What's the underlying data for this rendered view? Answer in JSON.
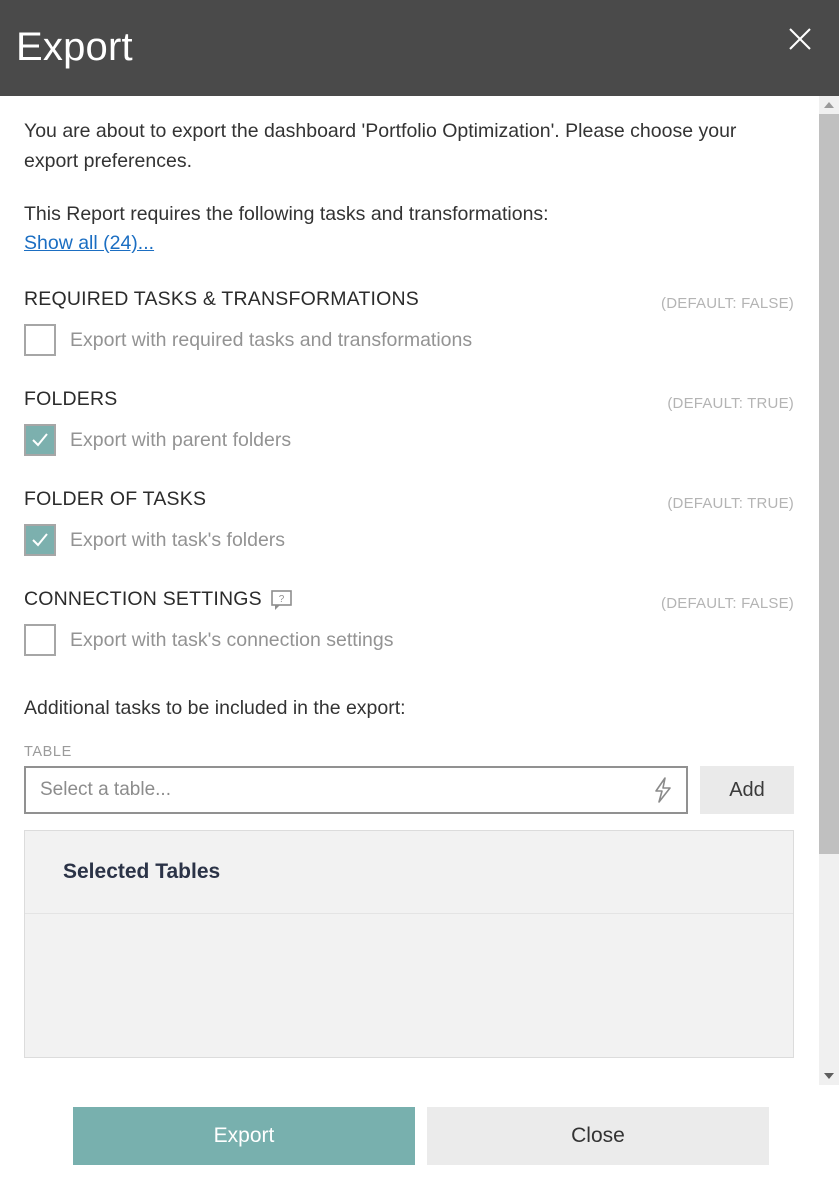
{
  "window": {
    "title": "Export",
    "close_icon": "close-icon"
  },
  "intro": {
    "paragraph": "You are about to export the dashboard 'Portfolio Optimization'. Please choose your export preferences.",
    "requires_line": "This Report requires the following tasks and transformations:",
    "show_all_link": "Show all (24)..."
  },
  "sections": [
    {
      "title": "REQUIRED TASKS & TRANSFORMATIONS",
      "default_tag": "(DEFAULT: FALSE)",
      "option_label": "Export with required tasks and transformations",
      "checked": false,
      "help_icon": null
    },
    {
      "title": "FOLDERS",
      "default_tag": "(DEFAULT: TRUE)",
      "option_label": "Export with parent folders",
      "checked": true,
      "help_icon": null
    },
    {
      "title": "FOLDER OF TASKS",
      "default_tag": "(DEFAULT: TRUE)",
      "option_label": "Export with task's folders",
      "checked": true,
      "help_icon": null
    },
    {
      "title": "CONNECTION SETTINGS",
      "default_tag": "(DEFAULT: FALSE)",
      "option_label": "Export with task's connection settings",
      "checked": false,
      "help_icon": "help-tooltip-icon"
    }
  ],
  "additional": {
    "heading": "Additional tasks to be included in the export:",
    "field_label": "TABLE",
    "select_placeholder": "Select a table...",
    "bolt_icon": "lightning-bolt-icon",
    "add_label": "Add"
  },
  "selected_tables": {
    "title": "Selected Tables",
    "rows": []
  },
  "footer": {
    "export_label": "Export",
    "close_label": "Close"
  },
  "scrollbar": {
    "up_arrow": "chevron-up-icon",
    "down_arrow": "chevron-down-icon"
  },
  "colors": {
    "titlebar": "#4a4a4a",
    "accent_teal": "#78b0ae",
    "link_blue": "#1b6ec2",
    "muted_text": "#939393",
    "panel_bg": "#f2f2f2",
    "panel_title": "#2b3347"
  }
}
